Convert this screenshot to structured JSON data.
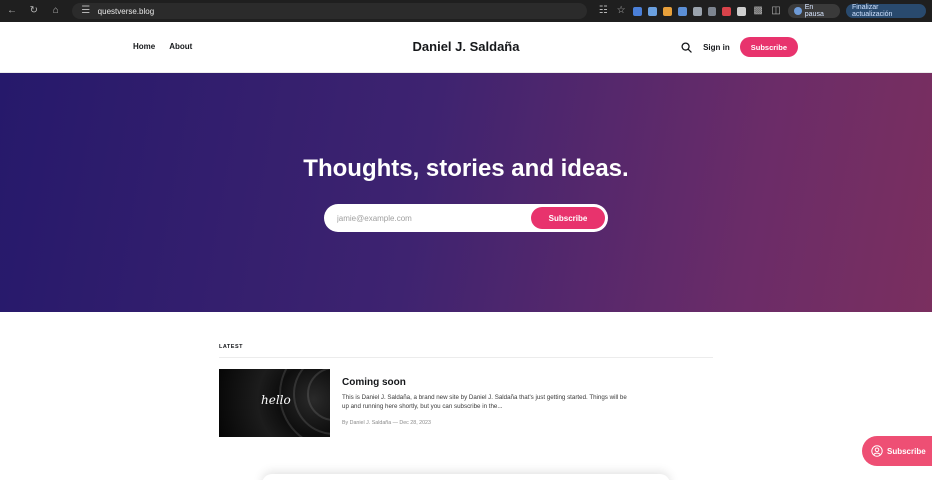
{
  "browser": {
    "url": "questverse.blog",
    "profile_label": "En pausa",
    "update_label": "Finalizar actualización"
  },
  "header": {
    "nav": [
      "Home",
      "About"
    ],
    "site_title": "Daniel J. Saldaña",
    "signin_label": "Sign in",
    "subscribe_label": "Subscribe"
  },
  "hero": {
    "title": "Thoughts, stories and ideas.",
    "email_placeholder": "jamie@example.com",
    "subscribe_label": "Subscribe",
    "gradient_colors": [
      "#26196b",
      "#7a2f5f"
    ]
  },
  "latest": {
    "section_label": "LATEST",
    "posts": [
      {
        "image_text": "hello",
        "title": "Coming soon",
        "excerpt": "This is Daniel J. Saldaña, a brand new site by Daniel J. Saldaña that's just getting started. Things will be up and running here shortly, but you can subscribe in the...",
        "meta": "By Daniel J. Saldaña — Dec 28, 2023"
      }
    ]
  },
  "floating": {
    "subscribe_label": "Subscribe"
  },
  "colors": {
    "accent": "#e8336d",
    "floating_accent": "#ee4f74"
  }
}
